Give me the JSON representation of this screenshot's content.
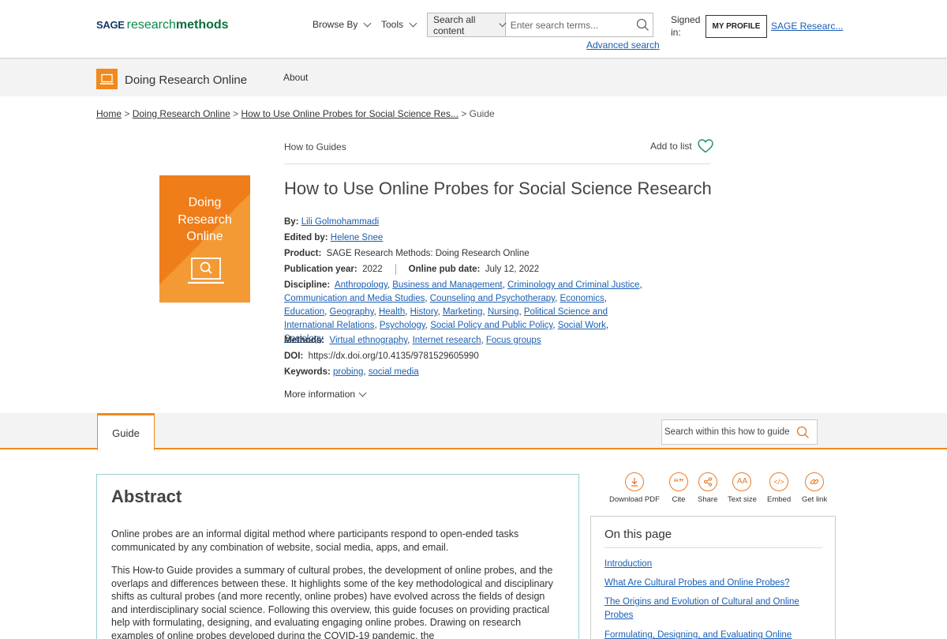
{
  "header": {
    "logo": {
      "sage": "SAGE",
      "research": "research",
      "methods": "methods"
    },
    "browse_by": "Browse By",
    "tools": "Tools",
    "search_scope": "Search all content",
    "search_placeholder": "Enter search terms...",
    "advanced_search": "Advanced search",
    "signed_in": "Signed in:",
    "my_profile": "MY PROFILE",
    "account_link": "SAGE Researc..."
  },
  "subheader": {
    "product": "Doing Research Online",
    "about": "About"
  },
  "breadcrumb": {
    "home": "Home",
    "sep": ">",
    "collection": "Doing Research Online",
    "item": "How to Use Online Probes for Social Science Res...",
    "current": "Guide"
  },
  "cover": {
    "line1": "Doing",
    "line2": "Research",
    "line3": "Online"
  },
  "content_type": "How to Guides",
  "add_to_list": "Add to list",
  "title": "How to Use Online Probes for Social Science Research",
  "meta": {
    "by_label": "By:",
    "author": "Lili Golmohammadi",
    "edited_label": "Edited by:",
    "editor": "Helene Snee",
    "product_label": "Product:",
    "product": "SAGE Research Methods: Doing Research Online",
    "pubyear_label": "Publication year:",
    "pubyear": "2022",
    "onlinepub_label": "Online pub date:",
    "onlinepub": "July 12, 2022",
    "discipline_label": "Discipline:",
    "disciplines": [
      "Anthropology",
      "Business and Management",
      "Criminology and Criminal Justice",
      "Communication and Media Studies",
      "Counseling and Psychotherapy",
      "Economics",
      "Education",
      "Geography",
      "Health",
      "History",
      "Marketing",
      "Nursing",
      "Political Science and International Relations",
      "Psychology",
      "Social Policy and Public Policy",
      "Social Work",
      "Sociology"
    ],
    "methods_label": "Methods:",
    "methods": [
      "Virtual ethnography",
      "Internet research",
      "Focus groups"
    ],
    "doi_label": "DOI:",
    "doi": "https://dx.doi.org/10.4135/9781529605990",
    "keywords_label": "Keywords:",
    "keywords": [
      "probing",
      "social media"
    ],
    "more_info": "More information"
  },
  "tabs": {
    "guide": "Guide",
    "search_within_placeholder": "Search within this how to guide"
  },
  "abstract": {
    "heading": "Abstract",
    "p1": "Online probes are an informal digital method where participants respond to open-ended tasks communicated by any combination of website, social media, apps, and email.",
    "p2": "This How-to Guide provides a summary of cultural probes, the development of online probes, and the overlaps and differences between these. It highlights some of the key methodological and disciplinary shifts as cultural probes (and more recently, online probes) have evolved across the fields of design and interdisciplinary social science. Following this overview, this guide focuses on providing practical help with formulating, designing, and evaluating engaging online probes. Drawing on research examples of online probes developed during the COVID-19 pandemic, the"
  },
  "tools": [
    {
      "label": "Download PDF",
      "icon": "download-icon"
    },
    {
      "label": "Cite",
      "icon": "quote-icon"
    },
    {
      "label": "Share",
      "icon": "share-icon"
    },
    {
      "label": "Text size",
      "icon": "text-size-icon"
    },
    {
      "label": "Embed",
      "icon": "code-icon"
    },
    {
      "label": "Get link",
      "icon": "link-icon"
    }
  ],
  "on_this_page": {
    "heading": "On this page",
    "links": [
      "Introduction",
      "What Are Cultural Probes and Online Probes?",
      "The Origins and Evolution of Cultural and Online Probes",
      "Formulating, Designing, and Evaluating Online Probes"
    ]
  },
  "colors": {
    "accent": "#ee7d1a",
    "link": "#1a5fb4",
    "brand_green": "#0b8a4a"
  }
}
